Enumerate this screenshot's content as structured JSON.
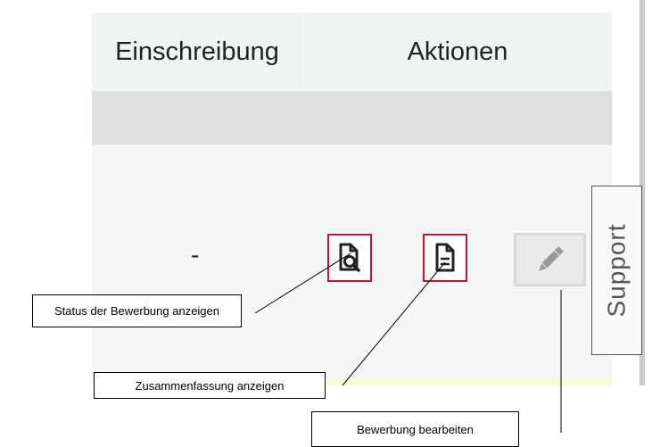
{
  "table": {
    "headers": [
      "Einschreibung",
      "Aktionen"
    ],
    "row": {
      "einschreibung": "-"
    }
  },
  "actions": {
    "view_status": {
      "icon": "document-search-icon"
    },
    "view_summary": {
      "icon": "document-text-icon"
    },
    "edit": {
      "icon": "pencil-icon",
      "disabled": true
    }
  },
  "support": {
    "label": "Support"
  },
  "annotations": {
    "status": "Status der Bewerbung anzeigen",
    "summary": "Zusammenfassung anzeigen",
    "edit": "Bewerbung bearbeiten"
  },
  "colors": {
    "accent": "#c8102e",
    "header_bg": "#eef3f4",
    "subheader_bg": "#dddfe0",
    "row_bg": "#f5f6f6",
    "highlight": "#f7f9d9"
  }
}
